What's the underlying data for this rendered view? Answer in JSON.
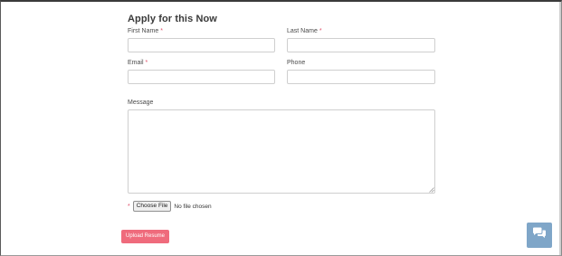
{
  "form": {
    "title": "Apply for this Now",
    "first_name_label": "First Name",
    "last_name_label": "Last Name",
    "email_label": "Email",
    "phone_label": "Phone",
    "message_label": "Message",
    "required_marker": "*",
    "first_name_value": "",
    "last_name_value": "",
    "email_value": "",
    "phone_value": "",
    "message_value": ""
  },
  "file_input": {
    "button_label": "Choose File",
    "status_text": "No file chosen"
  },
  "upload_button": {
    "label": "Upload Resume",
    "color": "#ef6b7c"
  },
  "chat_widget": {
    "icon": "chat-bubbles-icon",
    "color": "#7fa6c8"
  }
}
